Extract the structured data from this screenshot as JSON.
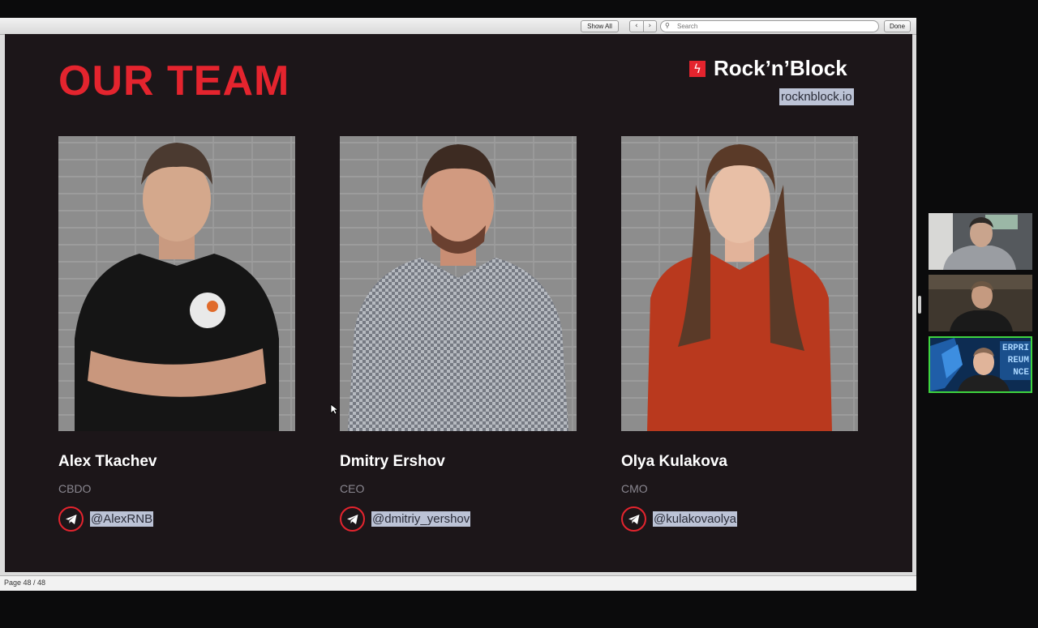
{
  "toolbar": {
    "show_all_label": "Show All",
    "prev_icon": "chevron-left-icon",
    "next_icon": "chevron-right-icon",
    "search_placeholder": "Search",
    "done_label": "Done"
  },
  "slide": {
    "title": "OUR TEAM",
    "brand_name": "Rock’n’Block",
    "brand_url": "rocknblock.io",
    "brand_color": "#e4242e",
    "background": "#1c1619",
    "members": [
      {
        "name": "Alex Tkachev",
        "role": "CBDO",
        "handle": "@AlexRNB",
        "icon": "telegram-icon"
      },
      {
        "name": "Dmitry Ershov",
        "role": "CEO",
        "handle": "@dmitriy_yershov",
        "icon": "telegram-icon"
      },
      {
        "name": "Olya Kulakova",
        "role": "CMO",
        "handle": "@kulakovaolya",
        "icon": "telegram-icon"
      }
    ]
  },
  "status": {
    "page_label": "Page 48 / 48"
  },
  "participants": {
    "count": 3,
    "active_speaker_border": "#3fd43f",
    "tile3_text": [
      "ERPRI",
      "REUM",
      "NCE"
    ]
  }
}
